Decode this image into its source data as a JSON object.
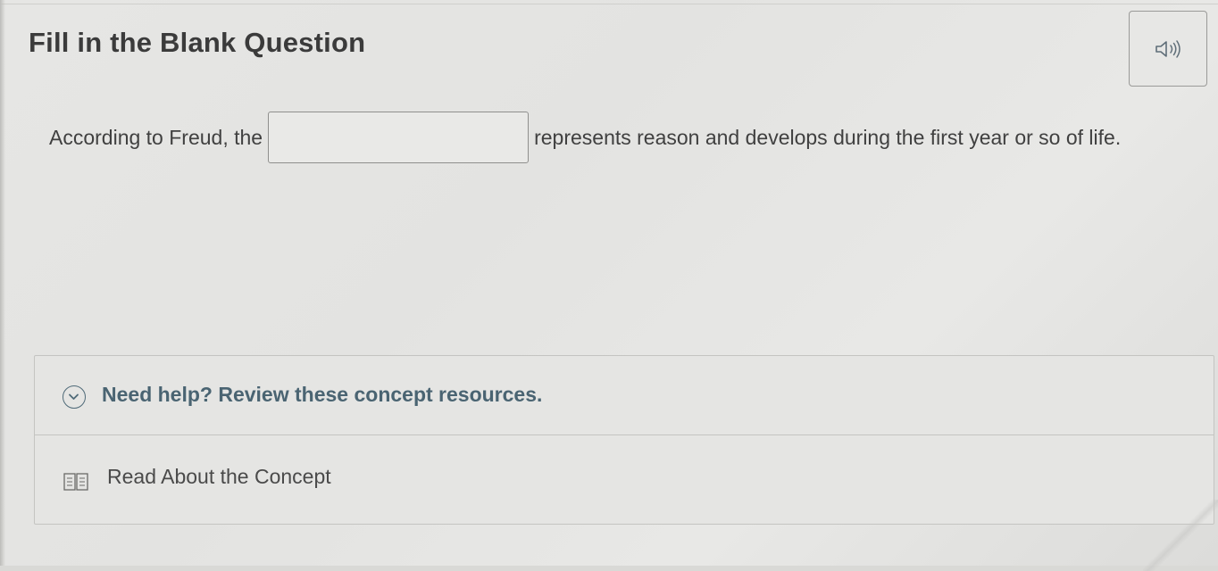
{
  "question": {
    "title": "Fill in the Blank Question",
    "audio_icon": "speaker-icon",
    "text_before": "According to Freud, the",
    "blank_value": "",
    "text_after": "represents reason and develops during the first year or so of life."
  },
  "help": {
    "title": "Need help? Review these concept resources.",
    "toggle_icon": "chevron-down-icon",
    "resources": [
      {
        "label": "Read About the Concept",
        "icon": "book-icon"
      }
    ]
  },
  "colors": {
    "background": "#e5e5e3",
    "title_text": "#3b3b3b",
    "help_accent": "#4a6472",
    "border": "#c4c4c1"
  }
}
